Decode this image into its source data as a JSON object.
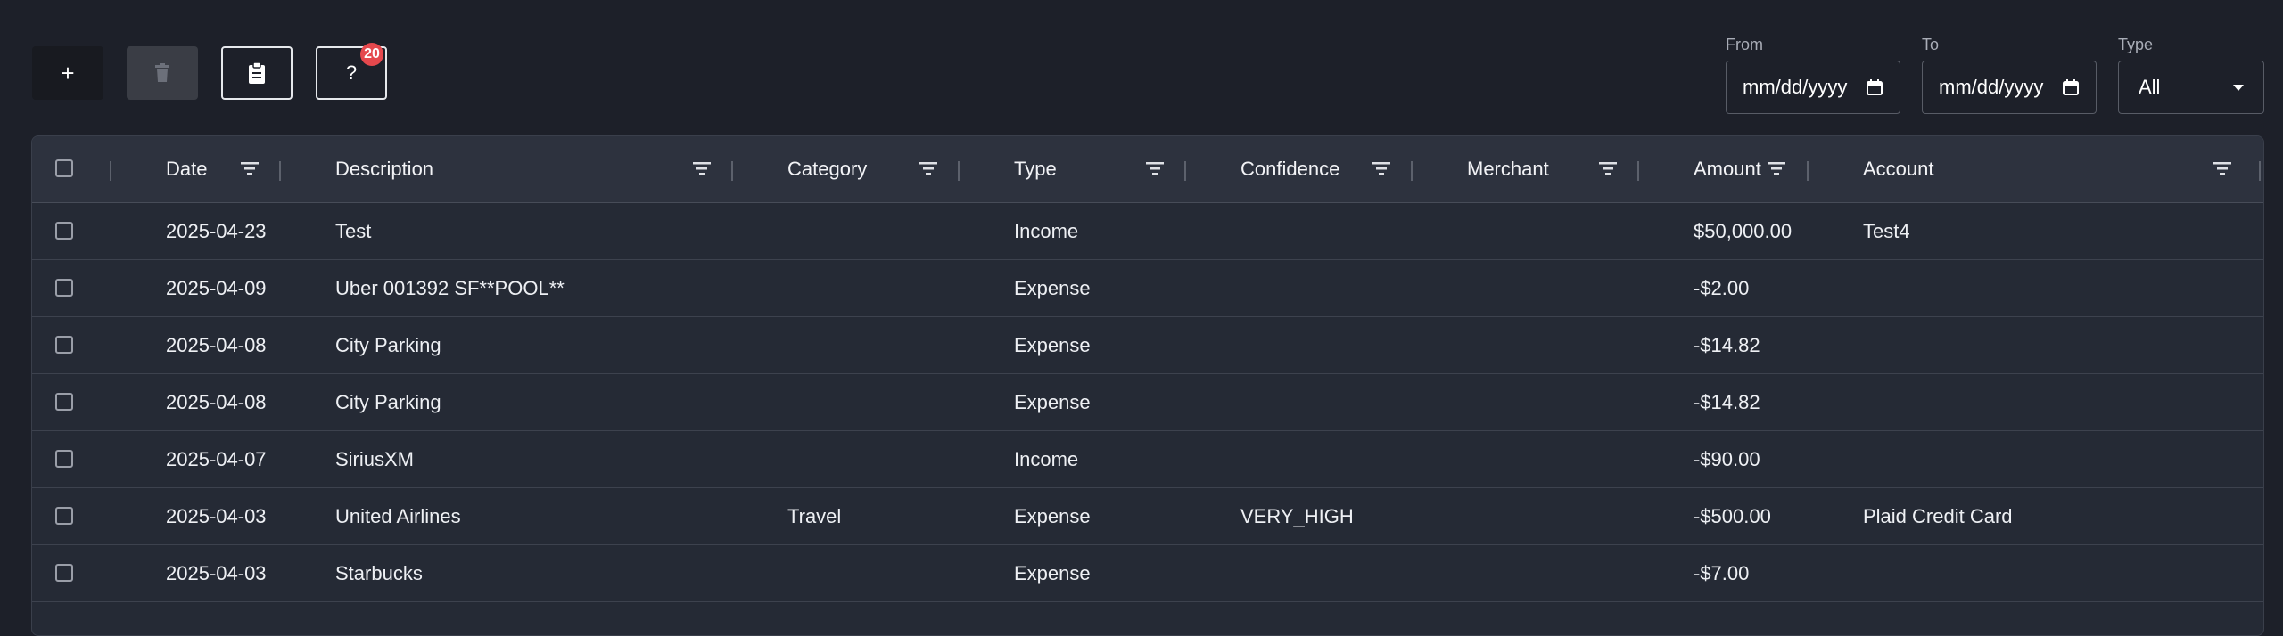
{
  "toolbar": {
    "add_label": "+",
    "delete_icon": "trash-icon",
    "clipboard_icon": "clipboard-icon",
    "help_label": "?",
    "help_badge": "20"
  },
  "filters": {
    "from_label": "From",
    "from_placeholder": "mm/dd/yyyy",
    "to_label": "To",
    "to_placeholder": "mm/dd/yyyy",
    "type_label": "Type",
    "type_value": "All"
  },
  "table": {
    "columns": [
      "Date",
      "Description",
      "Category",
      "Type",
      "Confidence",
      "Merchant",
      "Amount",
      "Account"
    ],
    "rows": [
      {
        "date": "2025-04-23",
        "description": "Test",
        "category": "",
        "type": "Income",
        "confidence": "",
        "merchant": "",
        "amount": "$50,000.00",
        "account": "Test4"
      },
      {
        "date": "2025-04-09",
        "description": "Uber 001392 SF**POOL**",
        "category": "",
        "type": "Expense",
        "confidence": "",
        "merchant": "",
        "amount": "-$2.00",
        "account": ""
      },
      {
        "date": "2025-04-08",
        "description": "City Parking",
        "category": "",
        "type": "Expense",
        "confidence": "",
        "merchant": "",
        "amount": "-$14.82",
        "account": ""
      },
      {
        "date": "2025-04-08",
        "description": "City Parking",
        "category": "",
        "type": "Expense",
        "confidence": "",
        "merchant": "",
        "amount": "-$14.82",
        "account": ""
      },
      {
        "date": "2025-04-07",
        "description": "SiriusXM",
        "category": "",
        "type": "Income",
        "confidence": "",
        "merchant": "",
        "amount": "-$90.00",
        "account": ""
      },
      {
        "date": "2025-04-03",
        "description": "United Airlines",
        "category": "Travel",
        "type": "Expense",
        "confidence": "VERY_HIGH",
        "merchant": "",
        "amount": "-$500.00",
        "account": "Plaid Credit Card"
      },
      {
        "date": "2025-04-03",
        "description": "Starbucks",
        "category": "",
        "type": "Expense",
        "confidence": "",
        "merchant": "",
        "amount": "-$7.00",
        "account": ""
      }
    ]
  }
}
